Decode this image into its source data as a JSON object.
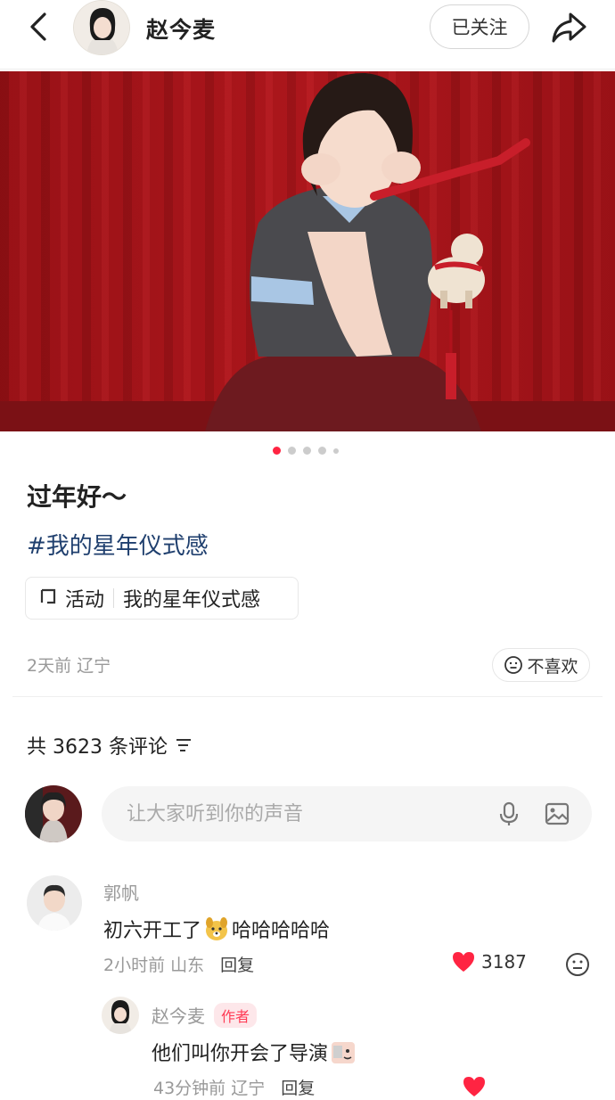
{
  "header": {
    "username": "赵今麦",
    "follow_label": "已关注"
  },
  "post": {
    "title": "过年好～",
    "hashtag": "#我的星年仪式感",
    "activity_label": "活动",
    "activity_name": "我的星年仪式感",
    "meta": "2天前 辽宁",
    "dislike_label": "不喜欢",
    "image_count": 5,
    "active_image": 1
  },
  "comments_header": {
    "count_text": "共 3623 条评论"
  },
  "comment_input": {
    "placeholder": "让大家听到你的声音"
  },
  "comments": [
    {
      "name": "郭帆",
      "text_before": "初六开工了",
      "text_after": "哈哈哈哈哈",
      "time_location": "2小时前 山东",
      "reply_label": "回复",
      "likes": "3187"
    }
  ],
  "replies": [
    {
      "name": "赵今麦",
      "badge": "作者",
      "text": "他们叫你开会了导演",
      "time_location": "43分钟前 辽宁",
      "reply_label": "回复"
    }
  ],
  "colors": {
    "accent": "#ff2442",
    "hashtag": "#1f3f6e",
    "curtain": "#a8141a"
  }
}
